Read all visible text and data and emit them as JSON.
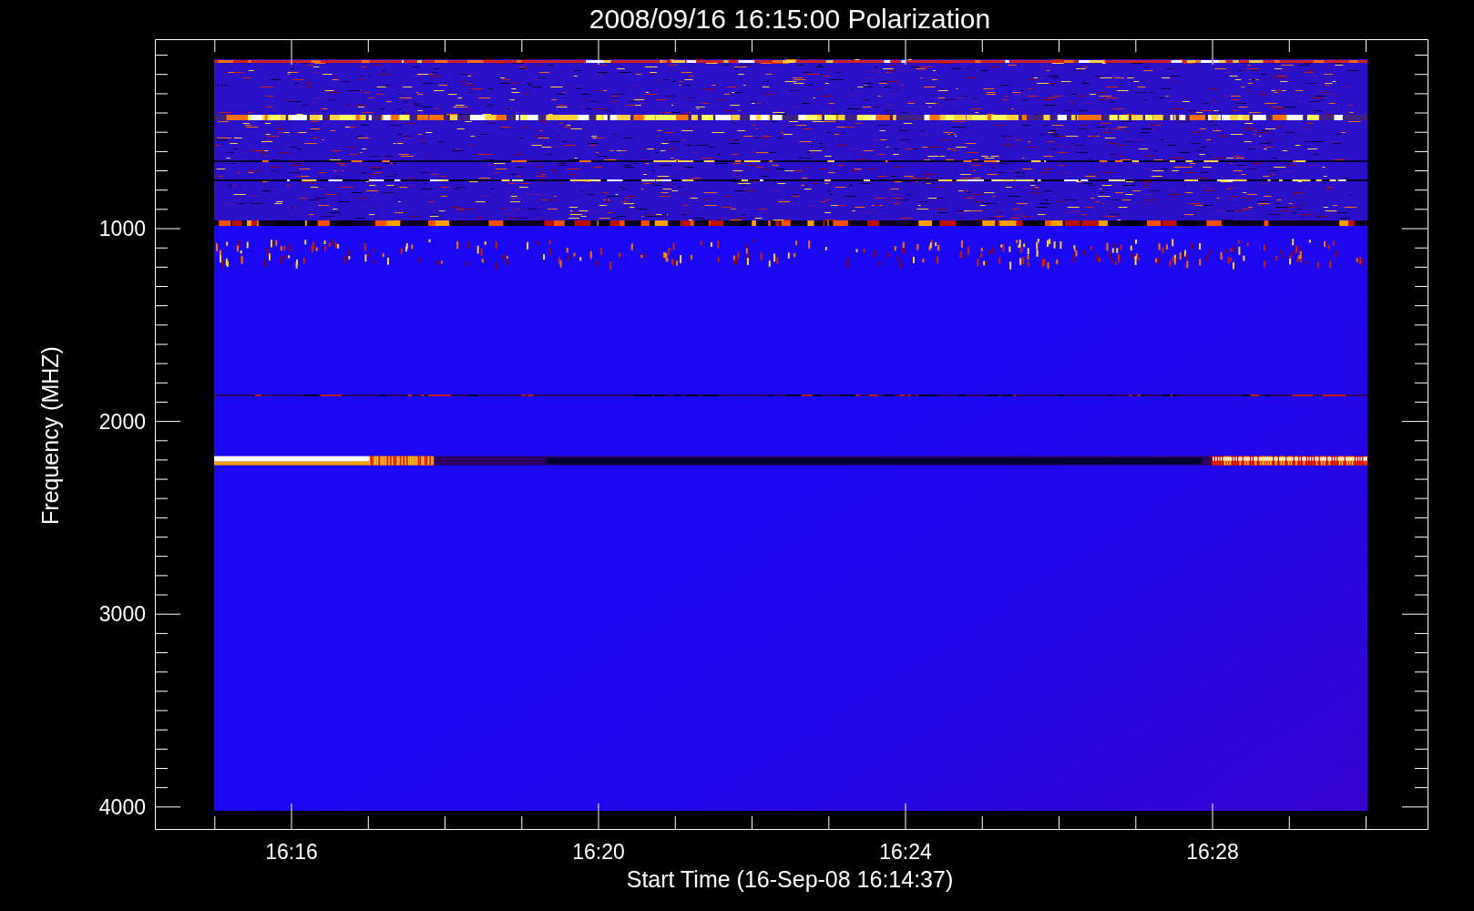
{
  "title": "2008/09/16 16:15:00 Polarization",
  "y_axis": {
    "title": "Frequency (MHZ)",
    "tick_labels": [
      "1000",
      "2000",
      "3000",
      "4000"
    ]
  },
  "x_axis": {
    "title": "Start Time (16-Sep-08 16:14:37)",
    "tick_labels": [
      "16:16",
      "16:20",
      "16:24",
      "16:28"
    ]
  }
}
